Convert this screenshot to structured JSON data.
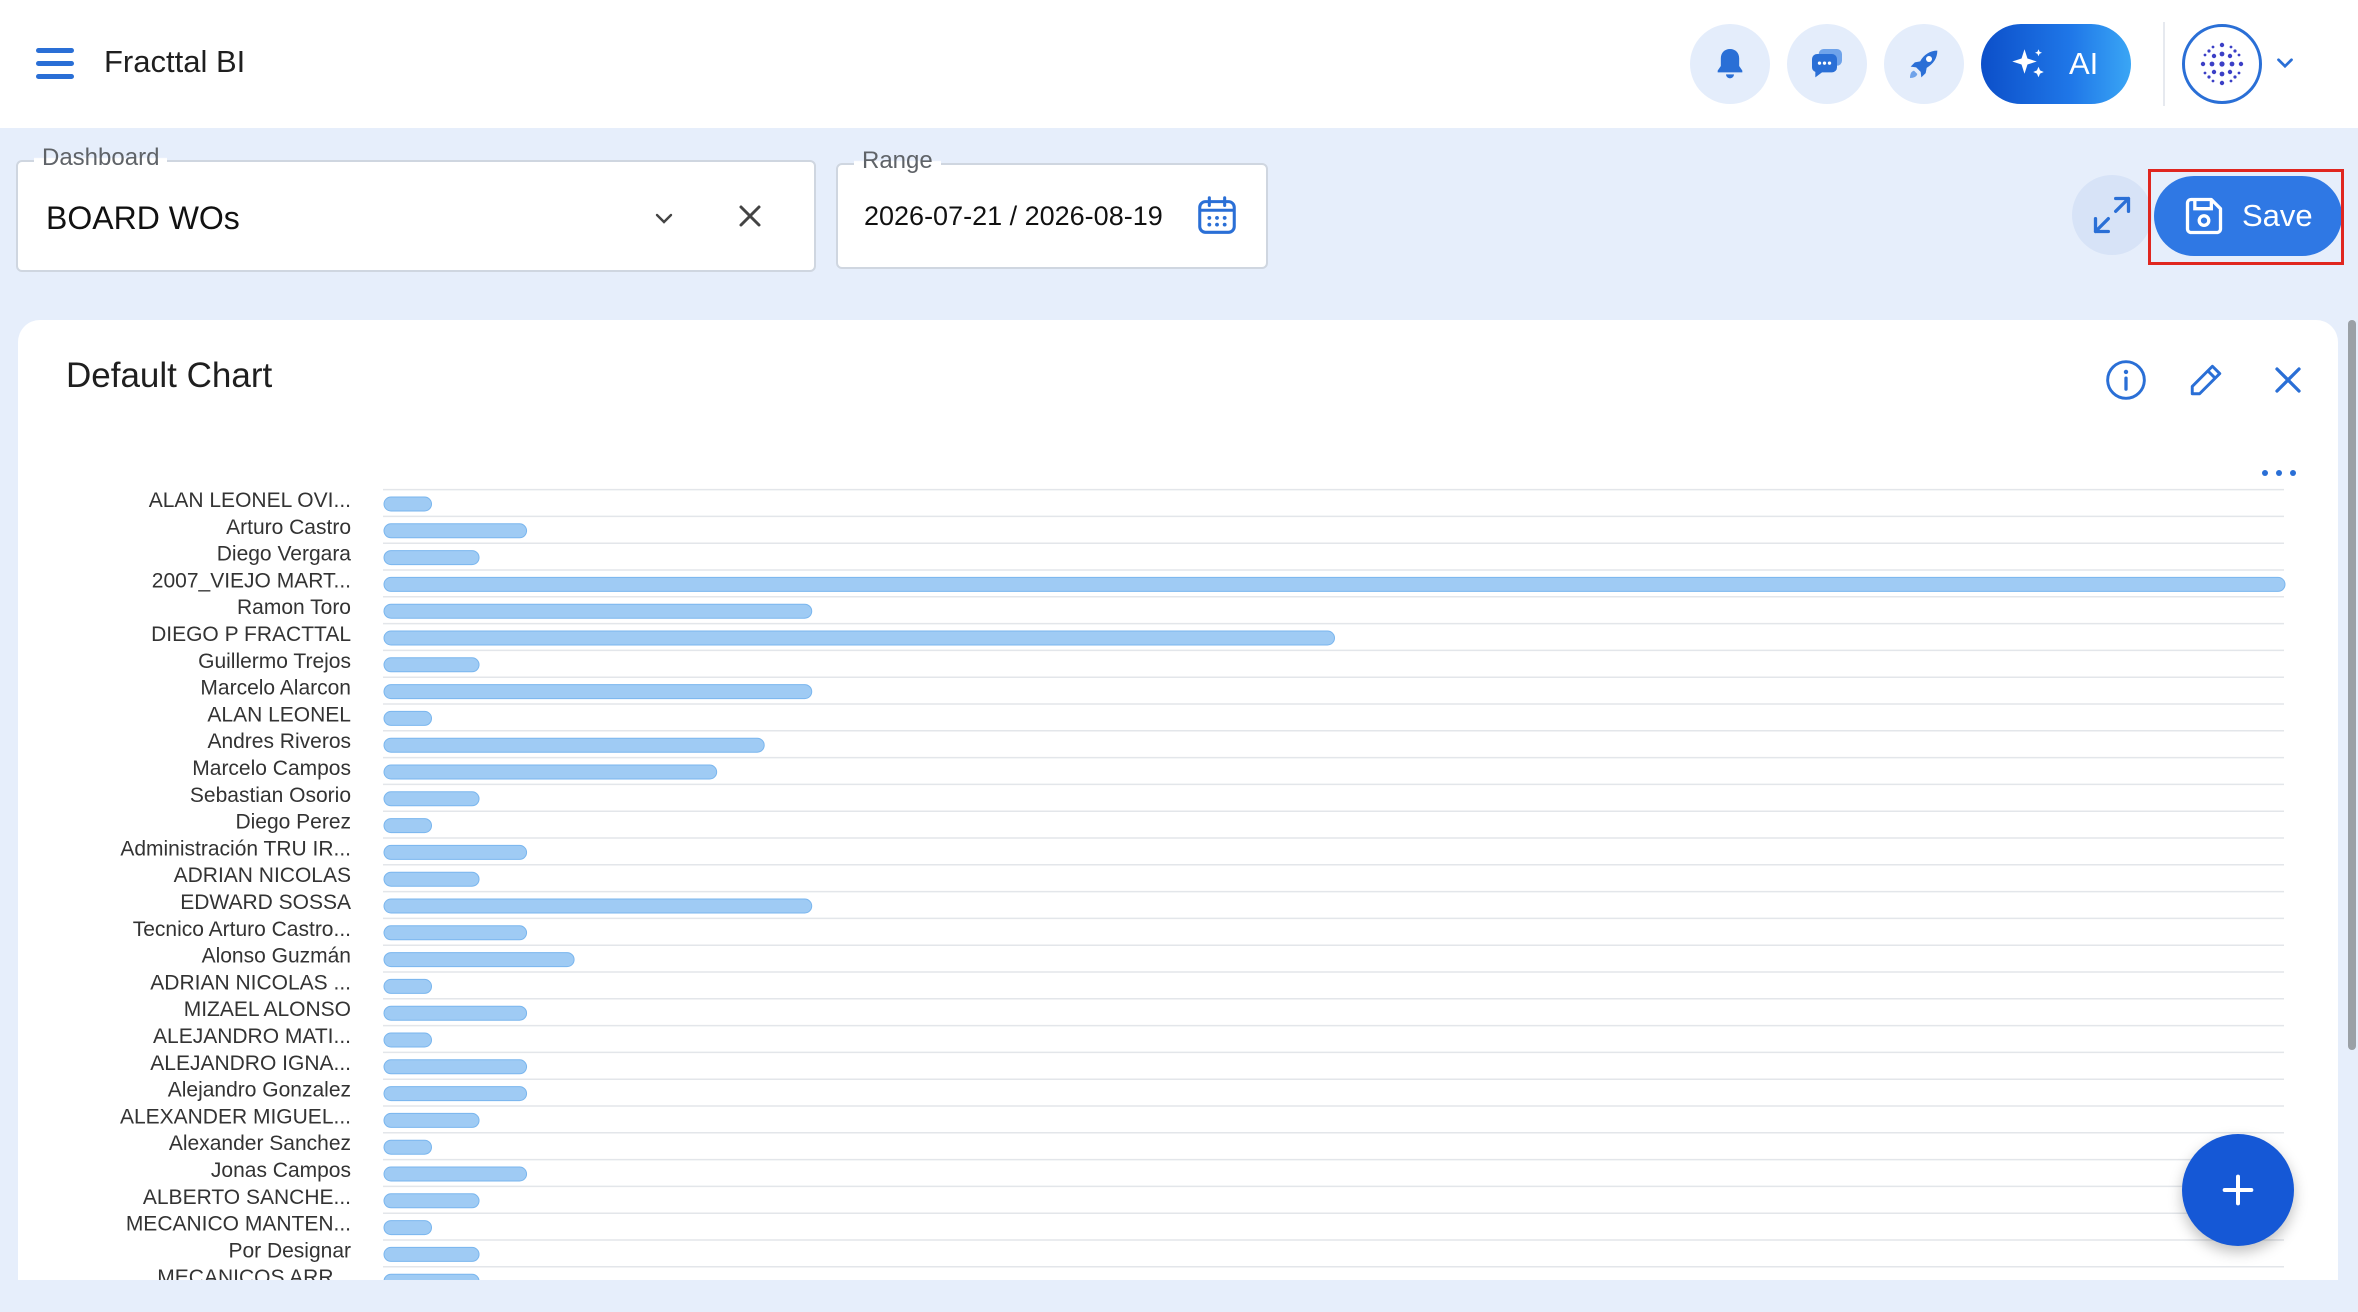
{
  "app": {
    "title": "Fracttal BI"
  },
  "topbar": {
    "ai_label": "AI",
    "icons": [
      "menu-icon",
      "bell-icon",
      "chat-icon",
      "rocket-icon",
      "sparkle-icon",
      "avatar-icon",
      "chevron-down-icon"
    ]
  },
  "filters": {
    "dashboard": {
      "label": "Dashboard",
      "value": "BOARD WOs"
    },
    "range": {
      "label": "Range",
      "value": "2026-07-21 / 2026-08-19"
    }
  },
  "toolbar": {
    "save_label": "Save"
  },
  "card": {
    "title": "Default Chart"
  },
  "colors": {
    "accent": "#2f78e4",
    "bar": "#9fcbf4",
    "bar_stroke": "#7ab6ee",
    "highlight": "#e0261f",
    "fab": "#1558d6"
  },
  "chart_data": {
    "type": "bar",
    "orientation": "horizontal",
    "categories": [
      "ALAN LEONEL OVI...",
      "Arturo Castro",
      "Diego Vergara",
      "2007_VIEJO MART...",
      "Ramon Toro",
      "DIEGO P FRACTTAL",
      "Guillermo Trejos",
      "Marcelo Alarcon",
      "ALAN LEONEL",
      "Andres Riveros",
      "Marcelo Campos",
      "Sebastian Osorio",
      "Diego Perez",
      "Administración TRU IR...",
      "ADRIAN NICOLAS",
      "EDWARD SOSSA",
      "Tecnico Arturo Castro...",
      "Alonso Guzmán",
      "ADRIAN NICOLAS ...",
      "MIZAEL ALONSO",
      "ALEJANDRO MATI...",
      "ALEJANDRO IGNA...",
      "Alejandro Gonzalez",
      "ALEXANDER MIGUEL...",
      "Alexander Sanchez",
      "Jonas Campos",
      "ALBERTO SANCHE...",
      "MECANICO MANTEN...",
      "Por Designar",
      "MECANICOS ARR..."
    ],
    "values": [
      1,
      3,
      2,
      40,
      9,
      20,
      2,
      9,
      1,
      8,
      7,
      2,
      1,
      3,
      2,
      9,
      3,
      4,
      1,
      3,
      1,
      3,
      3,
      2,
      1,
      3,
      2,
      1,
      2,
      2
    ],
    "xlim": [
      0,
      40
    ],
    "grid": true
  }
}
